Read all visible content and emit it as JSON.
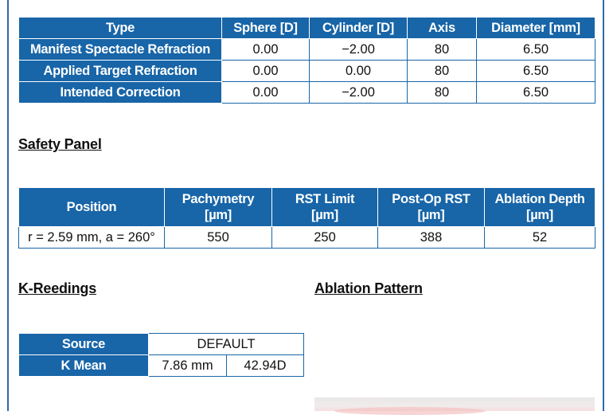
{
  "refraction_table": {
    "headers": [
      "Type",
      "Sphere [D]",
      "Cylinder [D]",
      "Axis",
      "Diameter [mm]"
    ],
    "rows": [
      [
        "Manifest Spectacle Refraction",
        "0.00",
        "−2.00",
        "80",
        "6.50"
      ],
      [
        "Applied Target Refraction",
        "0.00",
        "0.00",
        "80",
        "6.50"
      ],
      [
        "Intended Correction",
        "0.00",
        "−2.00",
        "80",
        "6.50"
      ]
    ]
  },
  "safety_panel": {
    "title": "Safety Panel",
    "headers": [
      {
        "line1": "Position",
        "line2": ""
      },
      {
        "line1": "Pachymetry",
        "line2": "[µm]"
      },
      {
        "line1": "RST Limit",
        "line2": "[µm]"
      },
      {
        "line1": "Post-Op RST",
        "line2": "[µm]"
      },
      {
        "line1": "Ablation Depth",
        "line2": "[µm]"
      }
    ],
    "row": [
      "r = 2.59 mm, a = 260°",
      "550",
      "250",
      "388",
      "52"
    ]
  },
  "k_readings": {
    "title": "K-Reedings",
    "source_label": "Source",
    "source_value": "DEFAULT",
    "kmean_label": "K Mean",
    "kmean_mm": "7.86 mm",
    "kmean_d": "42.94D"
  },
  "ablation_pattern": {
    "title": "Ablation Pattern"
  },
  "colors": {
    "header_blue": "#1865a8",
    "frame_blue": "#2f6aa8"
  }
}
